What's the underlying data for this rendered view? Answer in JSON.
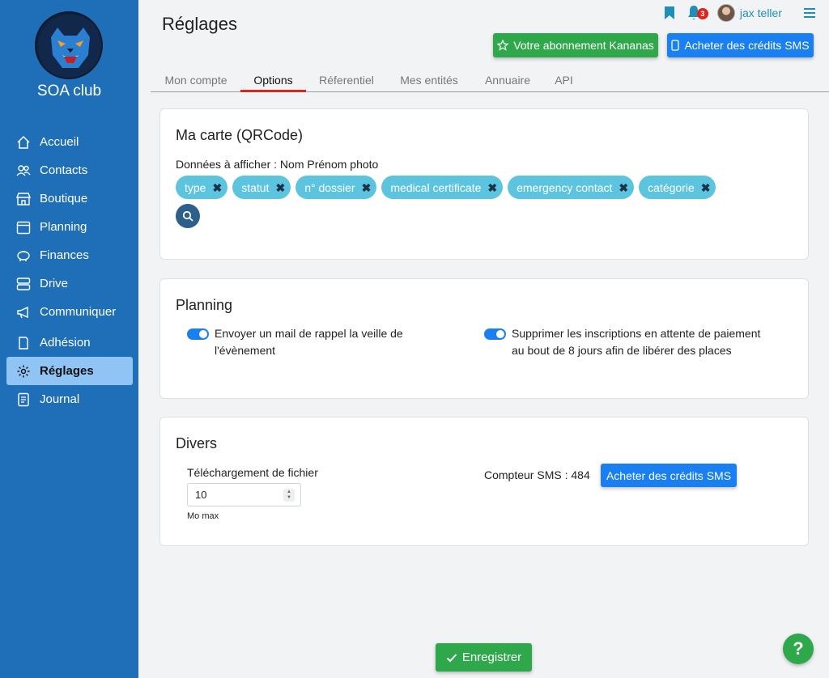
{
  "sidebar": {
    "club_name": "SOA club",
    "items": [
      {
        "label": "Accueil",
        "icon": "home-icon"
      },
      {
        "label": "Contacts",
        "icon": "users-icon"
      },
      {
        "label": "Boutique",
        "icon": "store-icon"
      },
      {
        "label": "Planning",
        "icon": "calendar-icon"
      },
      {
        "label": "Finances",
        "icon": "piggy-bank-icon"
      },
      {
        "label": "Drive",
        "icon": "server-icon"
      },
      {
        "label": "Communiquer",
        "icon": "megaphone-icon"
      },
      {
        "label": "Adhésion",
        "icon": "clipboard-icon"
      },
      {
        "label": "Réglages",
        "icon": "gear-icon",
        "active": true
      },
      {
        "label": "Journal",
        "icon": "journal-icon"
      }
    ]
  },
  "header": {
    "title": "Réglages",
    "notifications_count": "3",
    "username": "jax teller",
    "subscription_button": "Votre abonnement Kananas",
    "sms_button": "Acheter des crédits SMS"
  },
  "tabs": [
    {
      "label": "Mon compte"
    },
    {
      "label": "Options",
      "active": true
    },
    {
      "label": "Réferentiel"
    },
    {
      "label": "Mes entités"
    },
    {
      "label": "Annuaire"
    },
    {
      "label": "API"
    }
  ],
  "qrcode_card": {
    "title": "Ma carte (QRCode)",
    "display_label": "Données à afficher : Nom Prénom photo",
    "chips": [
      "type",
      "statut",
      "n° dossier",
      "medical certificate",
      "emergency contact",
      "catégorie"
    ],
    "chip_remove_glyph": "✖"
  },
  "planning_card": {
    "title": "Planning",
    "toggle1_text": "Envoyer un mail de rappel la veille de l'évènement",
    "toggle2_text": "Supprimer les inscriptions en attente de paiement au bout de 8 jours afin de libérer des places"
  },
  "divers_card": {
    "title": "Divers",
    "upload_label": "Téléchargement de fichier",
    "upload_value": "10",
    "upload_unit": "Mo max",
    "sms_counter": "Compteur SMS : 484",
    "sms_button": "Acheter des crédits SMS"
  },
  "footer": {
    "save_button": "Enregistrer",
    "help_glyph": "?"
  },
  "colors": {
    "sidebar": "#1f6fb8",
    "active_nav": "#8fc4f5",
    "green": "#2ea84a",
    "blue": "#1a7ff0",
    "chip": "#5cc4de",
    "tab_underline": "#e2231a"
  }
}
